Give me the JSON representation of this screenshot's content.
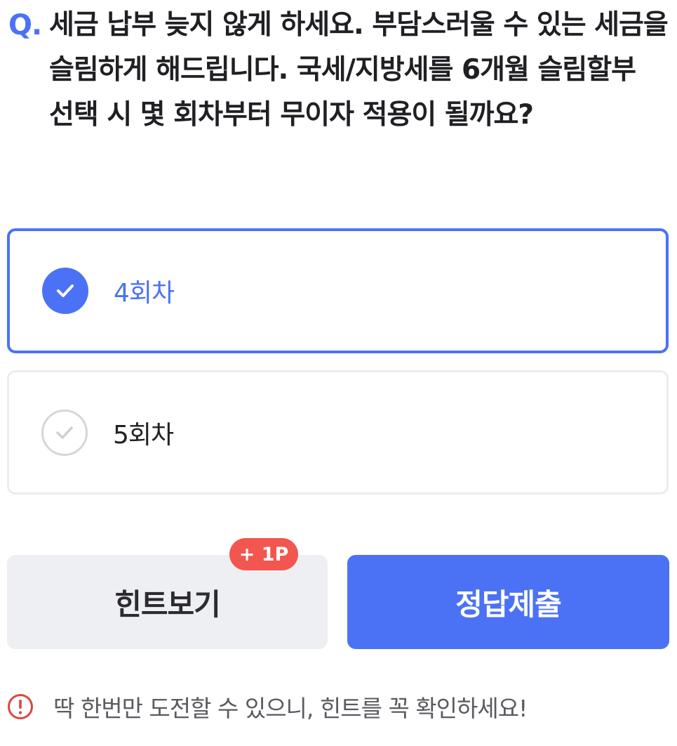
{
  "question": {
    "prefix": "Q.",
    "text": "세금 납부 늦지 않게 하세요. 부담스러울 수 있는 세금을 슬림하게 해드립니다. 국세/지방세를 6개월 슬림할부 선택 시 몇 회차부터 무이자 적용이 될까요?"
  },
  "options": [
    {
      "label": "4회차",
      "selected": true,
      "icon": "check-icon"
    },
    {
      "label": "5회차",
      "selected": false,
      "icon": "check-icon"
    }
  ],
  "buttons": {
    "hint_label": "힌트보기",
    "hint_badge": "+ 1P",
    "submit_label": "정답제출"
  },
  "notice": {
    "icon": "warning-icon",
    "text": "딱 한번만 도전할 수 있으니, 힌트를 꼭 확인하세요!"
  },
  "colors": {
    "accent": "#4b72f5",
    "badge": "#f2564e",
    "warning": "#e0453e",
    "hint_bg": "#eeeff3"
  }
}
